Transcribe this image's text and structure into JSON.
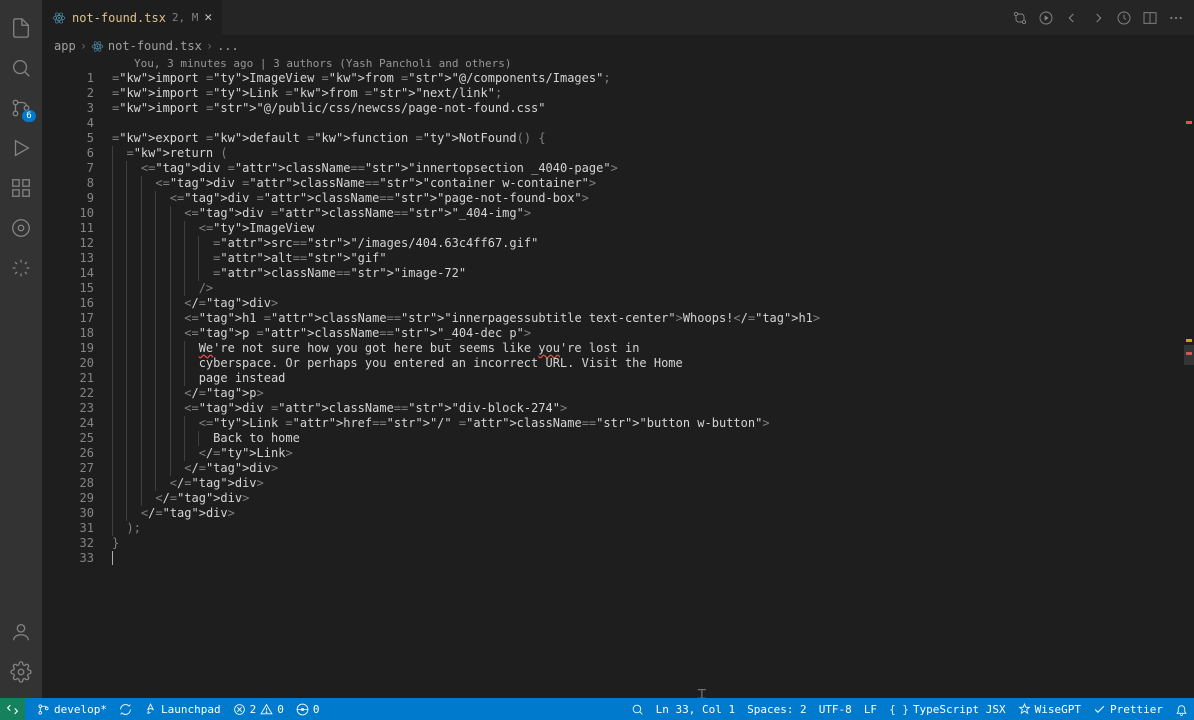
{
  "tab": {
    "name": "not-found.tsx",
    "problems": "2, M"
  },
  "breadcrumb": {
    "folder": "app",
    "file": "not-found.tsx",
    "tail": "..."
  },
  "codelens": "You, 3 minutes ago | 3 authors (Yash Pancholi and others)",
  "source_control_badge": "6",
  "lines": [
    "import ImageView from \"@/components/Images\";",
    "import Link from \"next/link\";",
    "import \"@/public/css/newcss/page-not-found.css\"",
    "",
    "export default function NotFound() {",
    "  return (",
    "    <div className=\"innertopsection _4040-page\">",
    "      <div className=\"container w-container\">",
    "        <div className=\"page-not-found-box\">",
    "          <div className=\"_404-img\">",
    "            <ImageView",
    "              src=\"/images/404.63c4ff67.gif\"",
    "              alt=\"gif\"",
    "              className=\"image-72\"",
    "            />",
    "          </div>",
    "          <h1 className=\"innerpagessubtitle text-center\">Whoops!</h1>",
    "          <p className=\"_404-dec p\">",
    "            We're not sure how you got here but seems like you're lost in",
    "            cyberspace. Or perhaps you entered an incorrect URL. Visit the Home",
    "            page instead",
    "          </p>",
    "          <div className=\"div-block-274\">",
    "            <Link href=\"/\" className=\"button w-button\">",
    "              Back to home",
    "            </Link>",
    "          </div>",
    "        </div>",
    "      </div>",
    "    </div>",
    "  );",
    "}",
    ""
  ],
  "status": {
    "branch": "develop*",
    "launchpad": "Launchpad",
    "errors": "2",
    "warnings": "0",
    "ports": "0",
    "cursor": "Ln 33, Col 1",
    "spaces": "Spaces: 2",
    "encoding": "UTF-8",
    "eol": "LF",
    "language": "TypeScript JSX",
    "wisegpt": "WiseGPT",
    "prettier": "Prettier"
  }
}
